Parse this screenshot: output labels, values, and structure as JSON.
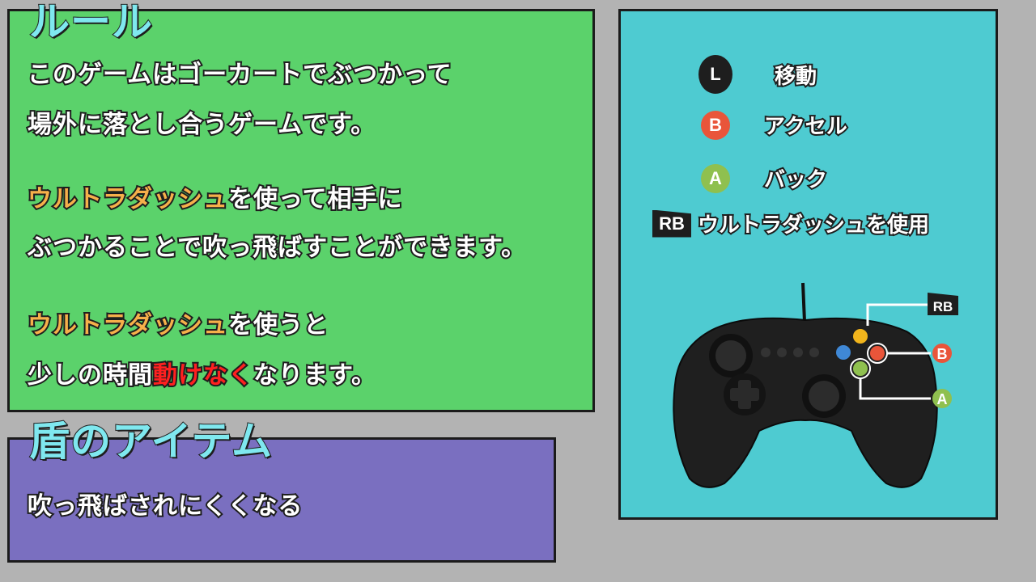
{
  "rules": {
    "title": "ルール",
    "line1": "このゲームはゴーカートでぶつかって",
    "line2": "場外に落とし合うゲームです。",
    "line3_highlight": "ウルトラダッシュ",
    "line3_rest": "を使って相手に",
    "line4": "ぶつかることで吹っ飛ばすことができます。",
    "line5_highlight": "ウルトラダッシュ",
    "line5_rest": "を使うと",
    "line6_pre": "少しの時間",
    "line6_red": "動けなく",
    "line6_post": "なります。"
  },
  "shield": {
    "title": "盾のアイテム",
    "description": "吹っ飛ばされにくくなる"
  },
  "controls": {
    "items": [
      {
        "key": "L",
        "label": "移動",
        "color": "#1e1e1e"
      },
      {
        "key": "B",
        "label": "アクセル",
        "color": "#e9553a"
      },
      {
        "key": "A",
        "label": "バック",
        "color": "#8fc04f"
      },
      {
        "key": "RB",
        "label": "ウルトラダッシュを使用",
        "color": "#1e1e1e"
      }
    ],
    "diagram_labels": {
      "rb": "RB",
      "b": "B",
      "a": "A"
    }
  },
  "colors": {
    "background": "#b3b3b3",
    "rules_panel": "#5bd26b",
    "shield_panel": "#7a6fc0",
    "controls_panel": "#4ecbd1",
    "heading_text": "#7fe8ef",
    "highlight_orange": "#f6b04a",
    "highlight_red": "#ff2020"
  }
}
